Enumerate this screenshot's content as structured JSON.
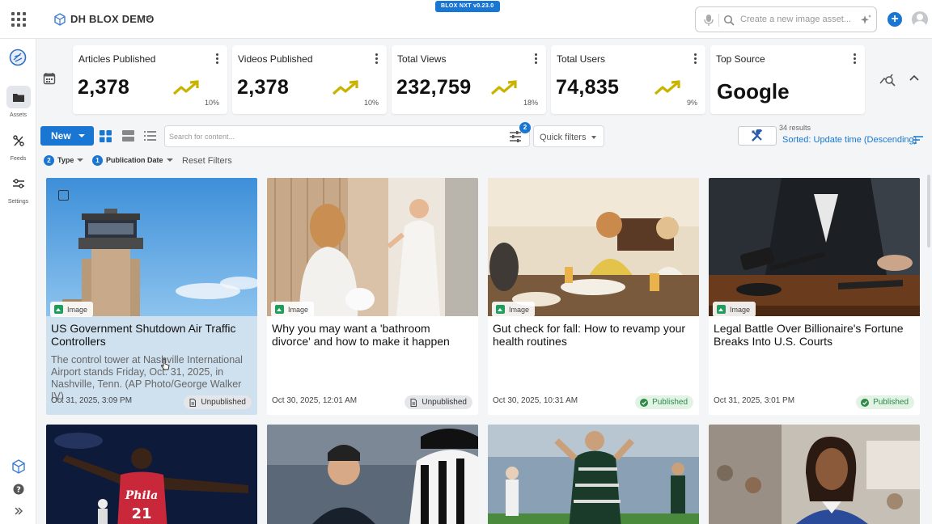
{
  "topbar": {
    "site_name": "DH BLOX DEMO",
    "version": "BLOX NXT v0.23.0",
    "search_placeholder": "Create a new image asset..."
  },
  "sidebar": {
    "items": [
      {
        "label": "Assets",
        "icon": "folder-icon",
        "active": true
      },
      {
        "label": "Feeds",
        "icon": "feeds-icon",
        "active": false
      },
      {
        "label": "Settings",
        "icon": "settings-icon",
        "active": false
      }
    ]
  },
  "stats": [
    {
      "title": "Articles Published",
      "value": "2,378",
      "pct": "10%"
    },
    {
      "title": "Videos Published",
      "value": "2,378",
      "pct": "10%"
    },
    {
      "title": "Total Views",
      "value": "232,759",
      "pct": "18%"
    },
    {
      "title": "Total Users",
      "value": "74,835",
      "pct": "9%"
    },
    {
      "title": "Top Source",
      "value": "Google"
    }
  ],
  "toolbar": {
    "new_label": "New",
    "search_placeholder": "Search for content...",
    "filter_count": "2",
    "quick_filters_label": "Quick filters",
    "results": "34 results",
    "sort": "Sorted: Update time (Descending)"
  },
  "filters": [
    {
      "label": "Type",
      "count": "2"
    },
    {
      "label": "Publication Date",
      "count": "1"
    }
  ],
  "reset_filters": "Reset Filters",
  "cards": [
    {
      "type": "Image",
      "title": "US Government Shutdown Air Traffic Controllers",
      "caption": "The control tower at Nashville International Airport stands Friday, Oct. 31, 2025, in Nashville, Tenn. (AP Photo/George Walker IV)",
      "date": "Oct 31, 2025, 3:09 PM",
      "status": "Unpublished"
    },
    {
      "type": "Image",
      "title": "Why you may want a 'bathroom divorce' and how to make it happen",
      "caption": "",
      "date": "Oct 30, 2025, 12:01 AM",
      "status": "Unpublished"
    },
    {
      "type": "Image",
      "title": "Gut check for fall: How to revamp your health routines",
      "caption": "",
      "date": "Oct 30, 2025, 10:31 AM",
      "status": "Published"
    },
    {
      "type": "Image",
      "title": "Legal Battle Over Billionaire's Fortune Breaks Into U.S. Courts",
      "caption": "",
      "date": "Oct 31, 2025, 3:01 PM",
      "status": "Published"
    }
  ],
  "photo_text": {
    "jersey_team": "Phila",
    "jersey_number": "21"
  },
  "colors": {
    "accent": "#1976d2",
    "published": "#2a8a46",
    "trend": "#c8b400"
  }
}
